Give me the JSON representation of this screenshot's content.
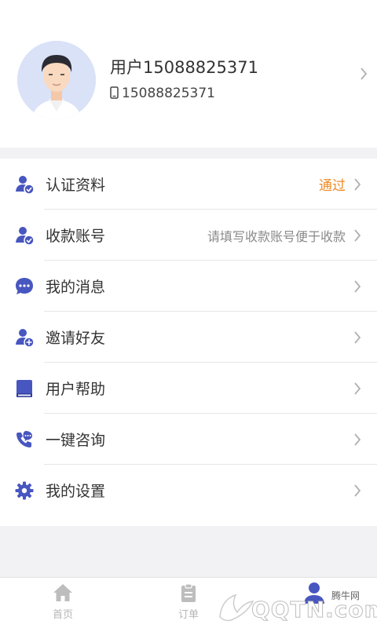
{
  "profile": {
    "username": "用户15088825371",
    "phone": "15088825371"
  },
  "menu": {
    "items": [
      {
        "label": "认证资料",
        "value": "通过",
        "icon": "verified-user-icon"
      },
      {
        "label": "收款账号",
        "value": "请填写收款账号便于收款",
        "icon": "account-user-icon"
      },
      {
        "label": "我的消息",
        "value": "",
        "icon": "message-bubble-icon"
      },
      {
        "label": "邀请好友",
        "value": "",
        "icon": "add-friend-icon"
      },
      {
        "label": "用户帮助",
        "value": "",
        "icon": "book-icon"
      },
      {
        "label": "一键咨询",
        "value": "",
        "icon": "phone-chat-icon"
      },
      {
        "label": "我的设置",
        "value": "",
        "icon": "gear-icon"
      }
    ]
  },
  "tabbar": {
    "home": "首页",
    "orders": "订单"
  },
  "watermark": {
    "brand": "腾牛网",
    "logo_text": "QQTN.com"
  },
  "colors": {
    "accent": "#4856c0",
    "status_pass": "#f08a22",
    "background": "#f2f2f5"
  }
}
